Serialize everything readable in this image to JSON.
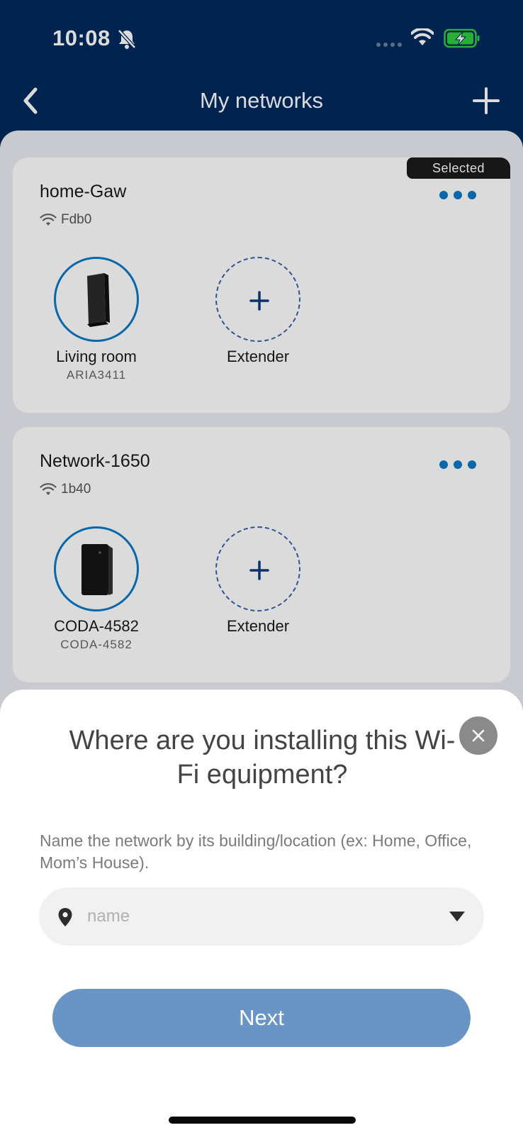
{
  "status_bar": {
    "time": "10:08"
  },
  "nav": {
    "title": "My networks"
  },
  "networks": [
    {
      "name": "home-Gaw",
      "ssid": "Fdb0",
      "selected_label": "Selected",
      "device": {
        "label": "Living room",
        "model": "ARIA3411"
      },
      "extender_label": "Extender"
    },
    {
      "name": "Network-1650",
      "ssid": "1b40",
      "device": {
        "label": "CODA-4582",
        "model": "CODA-4582"
      },
      "extender_label": "Extender"
    }
  ],
  "sheet": {
    "title": "Where are you installing this Wi-Fi equipment?",
    "description": "Name the network by its building/location (ex: Home, Office, Mom’s House).",
    "name_placeholder": "name",
    "name_value": "",
    "next_label": "Next"
  },
  "colors": {
    "header_bg": "#02295c",
    "accent": "#0b78c8",
    "next_button": "#6895c5",
    "selected_tag": "#1b1b1b"
  },
  "icons": [
    "back-icon",
    "add-icon",
    "wifi-icon",
    "more-icon",
    "plus-icon",
    "close-icon",
    "location-pin-icon",
    "dropdown-arrow-icon"
  ]
}
